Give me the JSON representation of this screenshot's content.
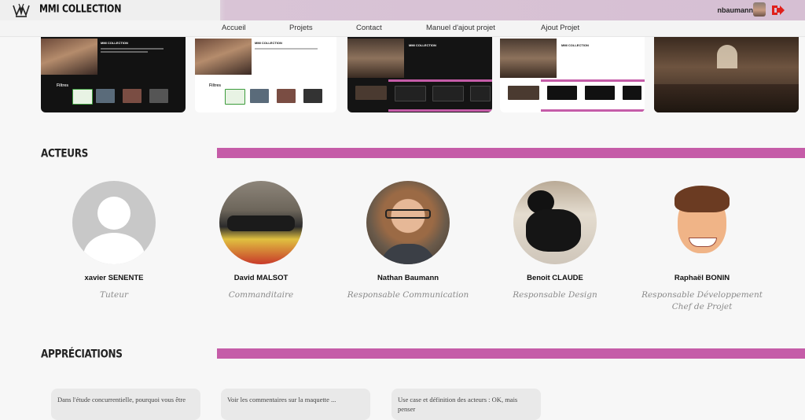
{
  "header": {
    "brand": "MMI COLLECTION",
    "username": "nbaumann",
    "logo_icon": "crown-logo-icon",
    "logout_icon": "logout-icon",
    "accent_color": "#c55ca8"
  },
  "nav": {
    "items": [
      "Accueil",
      "Projets",
      "Contact",
      "Manuel d'ajout projet",
      "Ajout Projet"
    ]
  },
  "screenshots": {
    "brand": "MMI COLLECTION",
    "filters_label": "Filtres",
    "count": 5
  },
  "sections": {
    "actors_title": "ACTEURS",
    "appreciations_title": "APPRÉCIATIONS"
  },
  "actors": [
    {
      "name": "xavier SENENTE",
      "role": "Tuteur",
      "role2": ""
    },
    {
      "name": "David MALSOT",
      "role": "Commanditaire",
      "role2": ""
    },
    {
      "name": "Nathan Baumann",
      "role": "Responsable Communication",
      "role2": ""
    },
    {
      "name": "Benoit CLAUDE",
      "role": "Responsable Design",
      "role2": ""
    },
    {
      "name": "Raphaël BONIN",
      "role": "Responsable Développement",
      "role2": "Chef de Projet"
    }
  ],
  "comments": [
    {
      "text": "Dans l'étude concurrentielle, pourquoi vous être"
    },
    {
      "text": "Voir les commentaires sur la maquette ..."
    },
    {
      "text": "Use case et définition des acteurs : OK, mais penser"
    }
  ]
}
